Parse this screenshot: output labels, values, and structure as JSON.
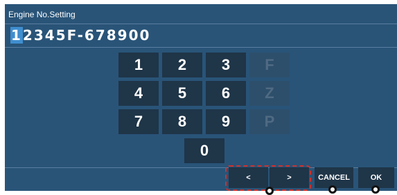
{
  "dialog": {
    "title": "Engine No.Setting",
    "value_cursor_char": "1",
    "value_rest": "2345F-678900"
  },
  "keypad": {
    "k1": "1",
    "k2": "2",
    "k3": "3",
    "kF": "F",
    "k4": "4",
    "k5": "5",
    "k6": "6",
    "kZ": "Z",
    "k7": "7",
    "k8": "8",
    "k9": "9",
    "kP": "P",
    "k0": "0"
  },
  "buttons": {
    "left": "<",
    "right": ">",
    "cancel": "CANCEL",
    "ok": "OK"
  },
  "colors": {
    "panel": "#295478",
    "key": "#1f3548",
    "highlight": "#d0302a"
  }
}
